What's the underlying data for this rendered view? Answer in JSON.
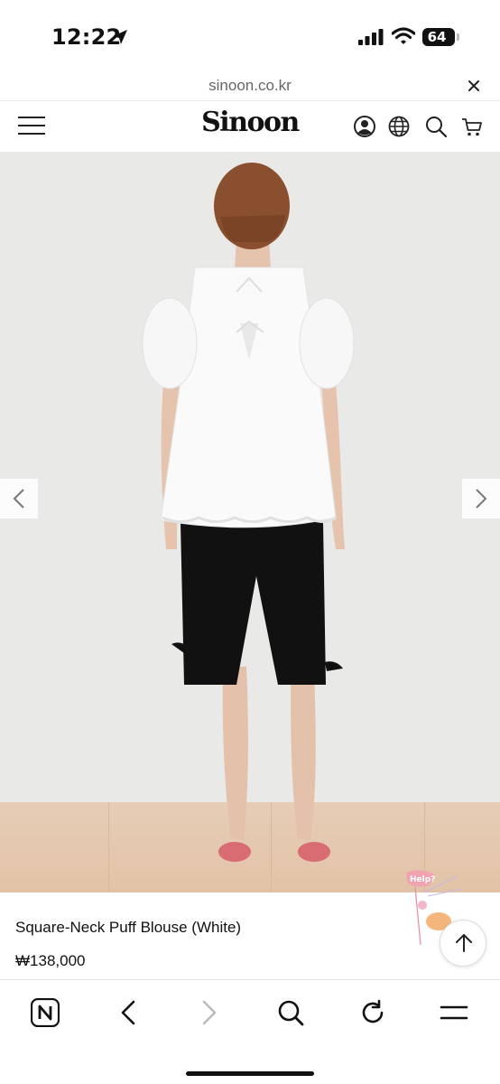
{
  "status_bar": {
    "time": "12:22",
    "battery": "64",
    "icons": [
      "location-arrow-icon",
      "signal-icon",
      "wifi-icon",
      "battery-icon"
    ]
  },
  "browser": {
    "url": "sinoon.co.kr",
    "close_icon": "close-icon"
  },
  "site_header": {
    "logo": "Sinoon",
    "icons": [
      "menu-icon",
      "account-icon",
      "globe-icon",
      "search-icon",
      "cart-icon"
    ]
  },
  "gallery": {
    "prev_icon": "chevron-left-icon",
    "next_icon": "chevron-right-icon"
  },
  "product": {
    "name": "Square-Neck Puff Blouse (White)",
    "price": "₩138,000",
    "help_badge": "Help?"
  },
  "toolbar": {
    "icons": [
      "naver-icon",
      "back-icon",
      "forward-icon",
      "search-icon",
      "reload-icon",
      "menu-icon"
    ]
  },
  "colors": {
    "background": "#ffffff",
    "wall": "#e9e9e8",
    "floor": "#e2c3a7",
    "text": "#111111",
    "muted": "#666666"
  }
}
